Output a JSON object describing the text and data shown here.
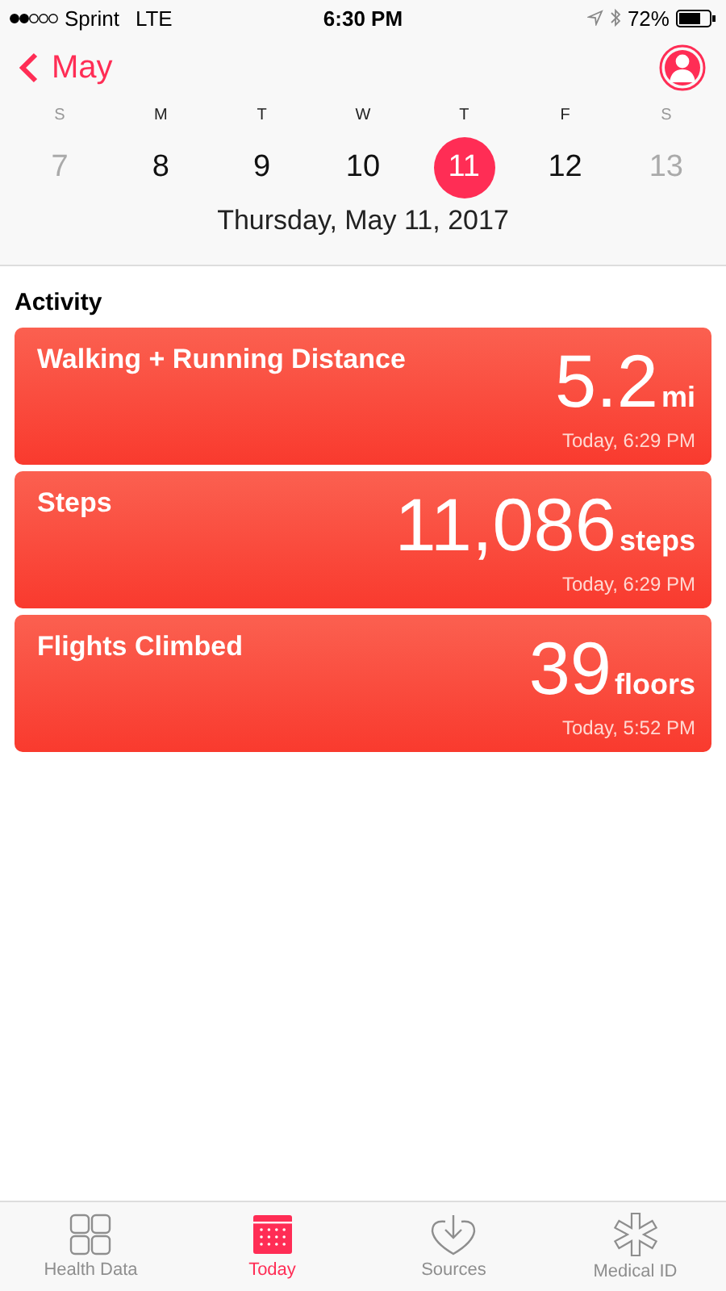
{
  "status_bar": {
    "carrier": "Sprint",
    "network": "LTE",
    "time": "6:30 PM",
    "battery": "72%"
  },
  "nav": {
    "back": "May"
  },
  "week": [
    {
      "weekday": "S",
      "date": "7",
      "selected": false,
      "dimmed": true
    },
    {
      "weekday": "M",
      "date": "8",
      "selected": false,
      "dimmed": false
    },
    {
      "weekday": "T",
      "date": "9",
      "selected": false,
      "dimmed": false
    },
    {
      "weekday": "W",
      "date": "10",
      "selected": false,
      "dimmed": false
    },
    {
      "weekday": "T",
      "date": "11",
      "selected": true,
      "dimmed": false
    },
    {
      "weekday": "F",
      "date": "12",
      "selected": false,
      "dimmed": false
    },
    {
      "weekday": "S",
      "date": "13",
      "selected": false,
      "dimmed": true
    }
  ],
  "selected_date": "Thursday, May 11, 2017",
  "section_title": "Activity",
  "cards": [
    {
      "title": "Walking + Running Distance",
      "value": "5.2",
      "unit": "mi",
      "time": "Today, 6:29 PM"
    },
    {
      "title": "Steps",
      "value": "11,086",
      "unit": "steps",
      "time": "Today, 6:29 PM"
    },
    {
      "title": "Flights Climbed",
      "value": "39",
      "unit": "floors",
      "time": "Today, 5:52 PM"
    }
  ],
  "tabs": [
    {
      "kind": "grid",
      "label": "Health Data",
      "selected": false
    },
    {
      "kind": "calendar",
      "label": "Today",
      "selected": true
    },
    {
      "kind": "heart",
      "label": "Sources",
      "selected": false
    },
    {
      "kind": "asterisk",
      "label": "Medical ID",
      "selected": false
    }
  ]
}
